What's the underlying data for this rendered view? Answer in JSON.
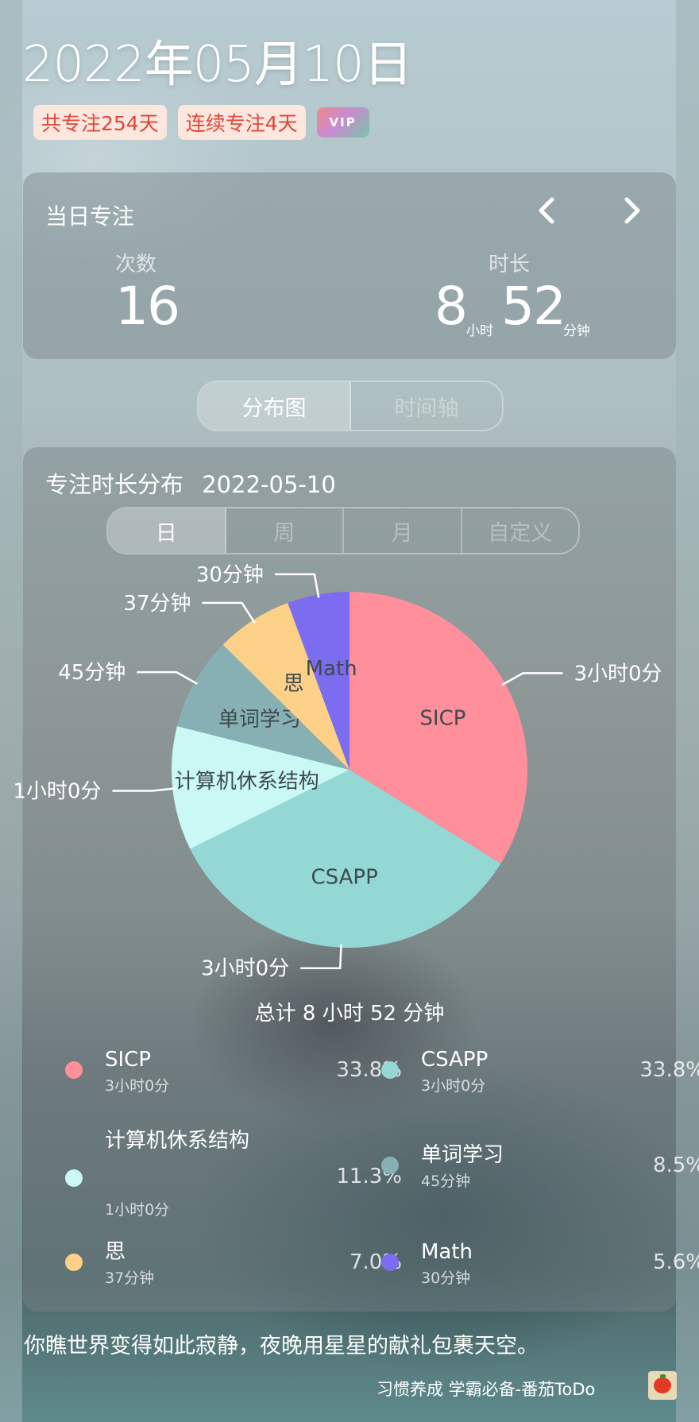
{
  "header": {
    "date": "2022年05月10日",
    "badges": [
      "共专注254天",
      "连续专注4天"
    ],
    "vip_label": "VIP"
  },
  "focus_card": {
    "title": "当日专注",
    "count_label": "次数",
    "count_value": "16",
    "duration_label": "时长",
    "hours": "8",
    "hours_unit": "小时",
    "minutes": "52",
    "minutes_unit": "分钟"
  },
  "view_tabs": [
    "分布图",
    "时间轴"
  ],
  "distribution": {
    "title": "专注时长分布",
    "date": "2022-05-10",
    "range_tabs": [
      "日",
      "周",
      "月",
      "自定义"
    ],
    "total": "总计 8 小时 52 分钟"
  },
  "chart_data": {
    "type": "pie",
    "unit": "minutes",
    "slices": [
      {
        "label": "SICP",
        "value": 180,
        "display": "3小时0分",
        "percent": "33.8%",
        "color": "#ff8f9b"
      },
      {
        "label": "CSAPP",
        "value": 180,
        "display": "3小时0分",
        "percent": "33.8%",
        "color": "#94d8d6"
      },
      {
        "label": "计算机休系结构",
        "value": 60,
        "display": "1小时0分",
        "percent": "11.3%",
        "color": "#c9f8f5"
      },
      {
        "label": "单词学习",
        "value": 45,
        "display": "45分钟",
        "percent": "8.5%",
        "color": "#86b0b4"
      },
      {
        "label": "思",
        "value": 37,
        "display": "37分钟",
        "percent": "7.0%",
        "color": "#fdd088"
      },
      {
        "label": "Math",
        "value": 30,
        "display": "30分钟",
        "percent": "5.6%",
        "color": "#7b6cf0"
      }
    ]
  },
  "quote": "你瞧世界变得如此寂静，夜晚用星星的献礼包裹天空。",
  "footer": "习惯养成 学霸必备-番茄ToDo"
}
